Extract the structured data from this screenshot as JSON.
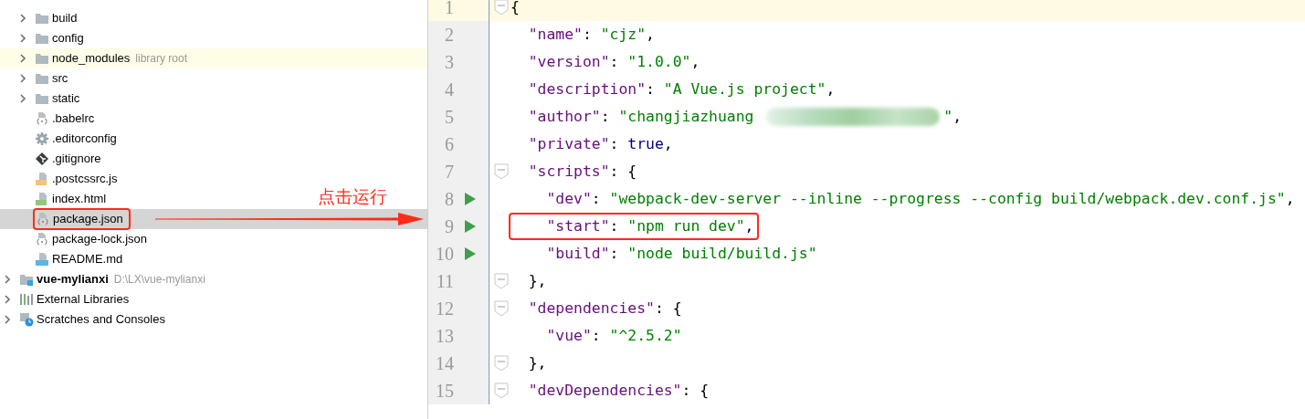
{
  "project_tree": [
    {
      "children": [
        {
          "label": "build",
          "kind": "folder",
          "expanded": false,
          "selected": false
        },
        {
          "label": "config",
          "kind": "folder",
          "expanded": false,
          "selected": false
        },
        {
          "label": "node_modules",
          "hint": "library root",
          "kind": "folder",
          "expanded": false,
          "selected": false,
          "highlighted": true
        },
        {
          "label": "src",
          "kind": "folder",
          "expanded": false,
          "selected": false
        },
        {
          "label": "static",
          "kind": "folder",
          "expanded": false,
          "selected": false
        },
        {
          "label": ".babelrc",
          "kind": "json",
          "selected": false
        },
        {
          "label": ".editorconfig",
          "kind": "settings",
          "selected": false
        },
        {
          "label": ".gitignore",
          "kind": "git",
          "selected": false
        },
        {
          "label": ".postcssrc.js",
          "kind": "js",
          "selected": false
        },
        {
          "label": "index.html",
          "kind": "html",
          "selected": false
        },
        {
          "label": "package.json",
          "kind": "json",
          "selected": true,
          "boxed": true
        },
        {
          "label": "package-lock.json",
          "kind": "json",
          "selected": false
        },
        {
          "label": "README.md",
          "kind": "md",
          "selected": false
        }
      ]
    },
    {
      "label": "vue-mylianxi",
      "hint": "D:\\LX\\vue-mylianxi",
      "kind": "project",
      "bold": true,
      "expanded": false,
      "selected": false
    },
    {
      "label": "External Libraries",
      "kind": "libraries",
      "expanded": false,
      "selected": false
    },
    {
      "label": "Scratches and Consoles",
      "kind": "scratches",
      "expanded": false,
      "selected": false
    }
  ],
  "annotation": {
    "text": "点击运行"
  },
  "editor": {
    "lines": [
      {
        "number": "1",
        "current": true,
        "fold": true,
        "tokens": [
          {
            "kind": "punct",
            "text": "{"
          }
        ]
      },
      {
        "number": "2",
        "tokens": [
          {
            "kind": "key",
            "text": "  \"name\""
          },
          {
            "kind": "punct",
            "text": ": "
          },
          {
            "kind": "string",
            "text": "\"cjz\""
          },
          {
            "kind": "punct",
            "text": ","
          }
        ]
      },
      {
        "number": "3",
        "tokens": [
          {
            "kind": "key",
            "text": "  \"version\""
          },
          {
            "kind": "punct",
            "text": ": "
          },
          {
            "kind": "string",
            "text": "\"1.0.0\""
          },
          {
            "kind": "punct",
            "text": ","
          }
        ]
      },
      {
        "number": "4",
        "tokens": [
          {
            "kind": "key",
            "text": "  \"description\""
          },
          {
            "kind": "punct",
            "text": ": "
          },
          {
            "kind": "string",
            "text": "\"A Vue.js project\""
          },
          {
            "kind": "punct",
            "text": ","
          }
        ]
      },
      {
        "number": "5",
        "tokens": [
          {
            "kind": "key",
            "text": "  \"author\""
          },
          {
            "kind": "punct",
            "text": ": "
          },
          {
            "kind": "string",
            "text": "\"changjiazhuang "
          },
          {
            "kind": "redacted"
          },
          {
            "kind": "string",
            "text": "\""
          },
          {
            "kind": "punct",
            "text": ","
          }
        ]
      },
      {
        "number": "6",
        "tokens": [
          {
            "kind": "key",
            "text": "  \"private\""
          },
          {
            "kind": "punct",
            "text": ": "
          },
          {
            "kind": "keyword",
            "text": "true"
          },
          {
            "kind": "punct",
            "text": ","
          }
        ]
      },
      {
        "number": "7",
        "fold": true,
        "tokens": [
          {
            "kind": "key",
            "text": "  \"scripts\""
          },
          {
            "kind": "punct",
            "text": ": {"
          }
        ]
      },
      {
        "number": "8",
        "run": true,
        "tokens": [
          {
            "kind": "key",
            "text": "    \"dev\""
          },
          {
            "kind": "punct",
            "text": ": "
          },
          {
            "kind": "string",
            "text": "\"webpack-dev-server --inline --progress --config build/webpack.dev.conf.js\""
          },
          {
            "kind": "punct",
            "text": ","
          }
        ]
      },
      {
        "number": "9",
        "run": true,
        "boxed": true,
        "tokens": [
          {
            "kind": "key",
            "text": "    \"start\""
          },
          {
            "kind": "punct",
            "text": ": "
          },
          {
            "kind": "string",
            "text": "\"npm run dev\""
          },
          {
            "kind": "punct",
            "text": ","
          }
        ]
      },
      {
        "number": "10",
        "run": true,
        "tokens": [
          {
            "kind": "key",
            "text": "    \"build\""
          },
          {
            "kind": "punct",
            "text": ": "
          },
          {
            "kind": "string",
            "text": "\"node build/build.js\""
          }
        ]
      },
      {
        "number": "11",
        "fold": true,
        "tokens": [
          {
            "kind": "punct",
            "text": "  },"
          }
        ]
      },
      {
        "number": "12",
        "fold": true,
        "tokens": [
          {
            "kind": "key",
            "text": "  \"dependencies\""
          },
          {
            "kind": "punct",
            "text": ": {"
          }
        ]
      },
      {
        "number": "13",
        "tokens": [
          {
            "kind": "key",
            "text": "    \"vue\""
          },
          {
            "kind": "punct",
            "text": ": "
          },
          {
            "kind": "string",
            "text": "\"^2.5.2\""
          }
        ]
      },
      {
        "number": "14",
        "fold": true,
        "tokens": [
          {
            "kind": "punct",
            "text": "  },"
          }
        ]
      },
      {
        "number": "15",
        "fold": true,
        "tokens": [
          {
            "kind": "key",
            "text": "  \"devDependencies\""
          },
          {
            "kind": "punct",
            "text": ": {"
          }
        ]
      }
    ]
  }
}
